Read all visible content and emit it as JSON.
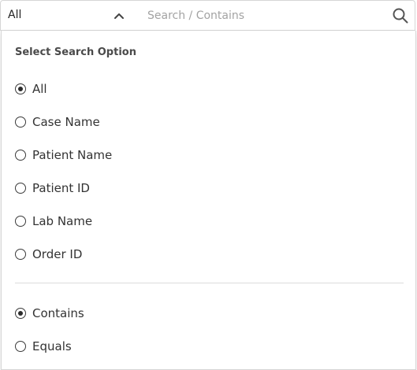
{
  "search": {
    "scope_value": "All",
    "placeholder": "Search / Contains"
  },
  "icons": {
    "chevron": "chevron-up-icon",
    "search": "search-icon"
  },
  "panel": {
    "title": "Select Search Option",
    "field_options": [
      {
        "label": "All",
        "checked": true
      },
      {
        "label": "Case Name",
        "checked": false
      },
      {
        "label": "Patient Name",
        "checked": false
      },
      {
        "label": "Patient ID",
        "checked": false
      },
      {
        "label": "Lab Name",
        "checked": false
      },
      {
        "label": "Order ID",
        "checked": false
      }
    ],
    "match_options": [
      {
        "label": "Contains",
        "checked": true
      },
      {
        "label": "Equals",
        "checked": false
      }
    ]
  }
}
